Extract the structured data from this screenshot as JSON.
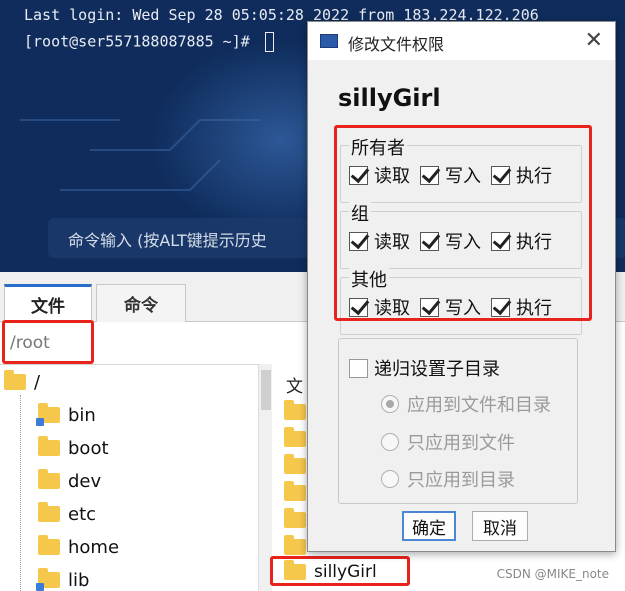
{
  "terminal": {
    "line1": "Last login: Wed Sep 28 05:05:28 2022 from 183.224.122.206",
    "line2": "[root@ser557188087885 ~]# ",
    "command_input_hint": "命令输入 (按ALT键提示历史"
  },
  "tabs": [
    {
      "label": "文件"
    },
    {
      "label": "命令"
    }
  ],
  "path": "/root",
  "tree": {
    "root": "/",
    "items": [
      "bin",
      "boot",
      "dev",
      "etc",
      "home",
      "lib"
    ]
  },
  "file_list": {
    "header": "文",
    "selected": "sillyGirl"
  },
  "watermark": "CSDN @MIKE_note",
  "dialog": {
    "title": "修改文件权限",
    "target_name": "sillyGirl",
    "groups": [
      {
        "label": "所有者",
        "read": "读取",
        "write": "写入",
        "execute": "执行"
      },
      {
        "label": "组",
        "read": "读取",
        "write": "写入",
        "execute": "执行"
      },
      {
        "label": "其他",
        "read": "读取",
        "write": "写入",
        "execute": "执行"
      }
    ],
    "recursive_label": "递归设置子目录",
    "apply_options": [
      "应用到文件和目录",
      "只应用到文件",
      "只应用到目录"
    ],
    "ok_label": "确定",
    "cancel_label": "取消"
  }
}
